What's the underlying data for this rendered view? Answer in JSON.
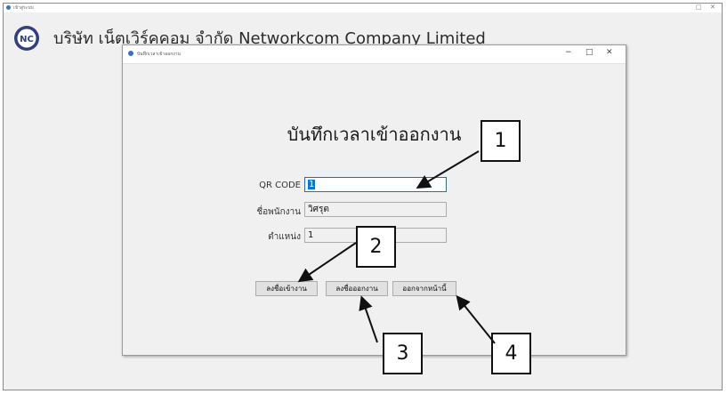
{
  "outer_window": {
    "title": "เข้าสู่ระบบ",
    "controls": [
      "□",
      "✕"
    ]
  },
  "brand": {
    "logo_text": "NC",
    "name": "บริษัท เน็ตเวิร์คคอม จำกัด   Networkcom Company Limited"
  },
  "dialog": {
    "title": "บันทึกเวลาเข้าออกงาน",
    "controls": [
      "−",
      "□",
      "✕"
    ]
  },
  "form": {
    "heading": "บันทึกเวลาเข้าออกงาน",
    "qr_label": "QR CODE",
    "qr_value": "1",
    "name_label": "ชื่อพนักงาน",
    "name_value": "วิศรุต",
    "position_label": "ตำแหน่ง",
    "position_value": "1"
  },
  "buttons": {
    "check_in": "ลงชื่อเข้างาน",
    "check_out": "ลงชื่อออกงาน",
    "exit": "ออกจากหน้านี้"
  },
  "callouts": [
    "1",
    "2",
    "3",
    "4"
  ],
  "colors": {
    "selection": "#0078d7",
    "button_face": "#e1e1e1",
    "window_bg": "#f0f0f0"
  }
}
